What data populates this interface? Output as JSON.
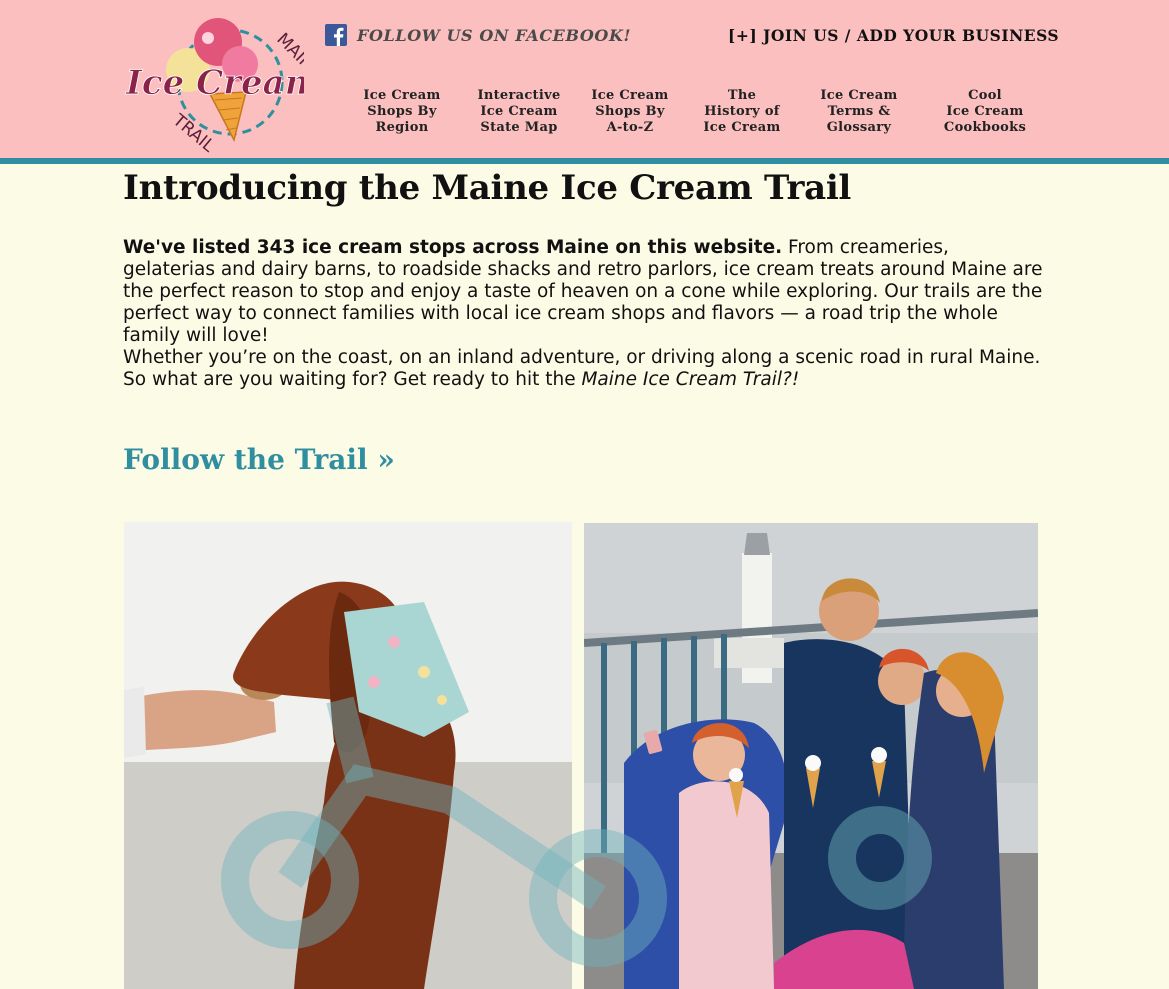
{
  "header": {
    "logo": {
      "line1": "MAINE",
      "line2": "Ice Cream",
      "line3": "TRAIL"
    },
    "facebook_label": "FOLLOW US ON FACEBOOK!",
    "join_label": "[+] JOIN US / ADD YOUR BUSINESS",
    "nav": [
      {
        "lines": [
          "Ice Cream",
          "Shops By",
          "Region"
        ]
      },
      {
        "lines": [
          "Interactive",
          "Ice Cream",
          "State Map"
        ]
      },
      {
        "lines": [
          "Ice Cream",
          "Shops By",
          "A-to-Z"
        ]
      },
      {
        "lines": [
          "The",
          "History of",
          "Ice Cream"
        ]
      },
      {
        "lines": [
          "Ice Cream",
          "Terms &",
          "Glossary"
        ]
      },
      {
        "lines": [
          "Cool",
          "Ice Cream",
          "Cookbooks"
        ]
      }
    ]
  },
  "main": {
    "title": "Introducing the Maine Ice Cream Trail",
    "intro_bold": "We've listed 343 ice cream stops across Maine on this website.",
    "intro_rest": " From creameries, gelaterias and dairy barns, to roadside shacks and retro parlors, ice cream treats around Maine are the perfect reason to stop and enjoy a taste of heaven on a cone while exploring. Our trails are the perfect way to connect families with local ice cream shops and flavors — a road trip the whole family will love!",
    "para2_text": "Whether you’re on the coast, on an inland adventure, or driving along a scenic road in rural Maine. So what are you waiting for? Get ready to hit the ",
    "para2_italic": "Maine Ice Cream Trail?!",
    "follow_label": "Follow the Trail  »"
  },
  "colors": {
    "header_bg": "#fabfbe",
    "accent_teal": "#2f8fa0",
    "page_bg": "#fcfbe6"
  }
}
